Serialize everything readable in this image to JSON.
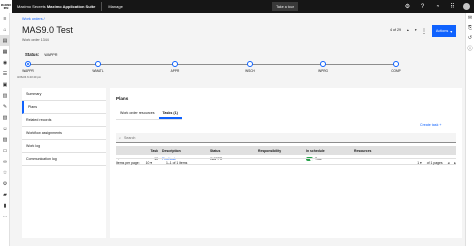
{
  "topbar": {
    "logo_line1": "MAXIMO",
    "logo_line2": "IBM",
    "app_title_prefix": "Maximo Secrets",
    "app_title_bold": "Maximo Application Suite",
    "manage": "Manage",
    "tour": "Take a tour"
  },
  "breadcrumb": "Work orders",
  "title": "MAS9.0 Test",
  "subtitle": "Work order 1344",
  "pager": "4 of 29",
  "actions_label": "Actions",
  "status": {
    "label": "Status:",
    "value": "WAPPR",
    "date": "3/26/24 6:43:40 pm",
    "nodes": [
      "WAPPR",
      "WMATL",
      "APPR",
      "WSCH",
      "INPRG",
      "COMP"
    ]
  },
  "sidebar": [
    "Summary",
    "Plans",
    "Related records",
    "Workflow assignments",
    "Work log",
    "Communication log"
  ],
  "plans": {
    "title": "Plans",
    "tabs": [
      "Work order resources",
      "Tasks (1)"
    ],
    "new_task": "Create task",
    "search_placeholder": "Search",
    "columns": [
      "Task",
      "Description",
      "Status",
      "Responsibility",
      "In schedule",
      "Resources"
    ],
    "row": {
      "task": "10",
      "description": "Find task",
      "status": "WAPPR",
      "responsibility": "",
      "in_schedule": "True",
      "resources": ""
    },
    "items_per_page_label": "Items per page:",
    "items_per_page": "10",
    "range": "1–1 of 1 items",
    "page": "1",
    "pages": "of 1 pages"
  }
}
